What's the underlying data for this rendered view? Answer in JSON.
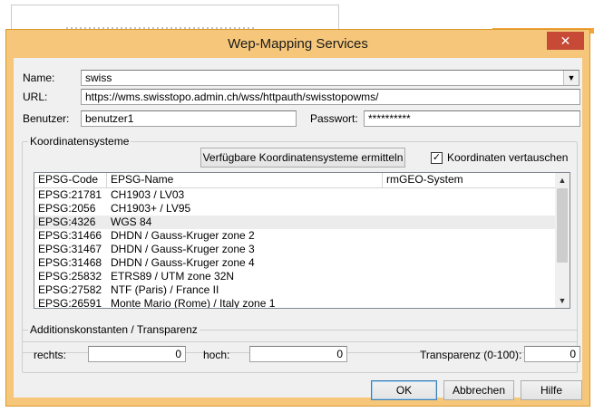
{
  "window": {
    "title": "Wep-Mapping Services",
    "close_glyph": "✕"
  },
  "form": {
    "name_label": "Name:",
    "name_value": "swiss",
    "url_label": "URL:",
    "url_value": "https://wms.swisstopo.admin.ch/wss/httpauth/swisstopowms/",
    "user_label": "Benutzer:",
    "user_value": "benutzer1",
    "password_label": "Passwort:",
    "password_value": "**********"
  },
  "crs_group": {
    "title": "Koordinatensysteme",
    "fetch_button": "Verfügbare Koordinatensysteme ermitteln",
    "swap_checkbox_label": "Koordinaten vertauschen",
    "swap_checked": true,
    "columns": [
      "EPSG-Code",
      "EPSG-Name",
      "rmGEO-System"
    ],
    "rows": [
      {
        "code": "EPSG:21781",
        "name": "CH1903 / LV03",
        "rmgeo": ""
      },
      {
        "code": "EPSG:2056",
        "name": "CH1903+ / LV95",
        "rmgeo": ""
      },
      {
        "code": "EPSG:4326",
        "name": "WGS 84",
        "rmgeo": ""
      },
      {
        "code": "EPSG:31466",
        "name": "DHDN / Gauss-Kruger zone 2",
        "rmgeo": ""
      },
      {
        "code": "EPSG:31467",
        "name": "DHDN / Gauss-Kruger zone 3",
        "rmgeo": ""
      },
      {
        "code": "EPSG:31468",
        "name": "DHDN / Gauss-Kruger zone 4",
        "rmgeo": ""
      },
      {
        "code": "EPSG:25832",
        "name": "ETRS89 / UTM zone 32N",
        "rmgeo": ""
      },
      {
        "code": "EPSG:27582",
        "name": "NTF (Paris) / France II",
        "rmgeo": ""
      },
      {
        "code": "EPSG:26591",
        "name": "Monte Mario (Rome) / Italy zone 1",
        "rmgeo": ""
      }
    ],
    "highlighted_row": 2
  },
  "addition_group": {
    "title": "Additionskonstanten / Transparenz",
    "right_label": "rechts:",
    "right_value": "0",
    "up_label": "hoch:",
    "up_value": "0",
    "transparency_label": "Transparenz (0-100):",
    "transparency_value": "0"
  },
  "buttons": {
    "ok": "OK",
    "cancel": "Abbrechen",
    "help": "Hilfe"
  },
  "colors": {
    "title_bar": "#f6c77a",
    "close_button": "#c74a36",
    "client": "#f0f0f0"
  }
}
